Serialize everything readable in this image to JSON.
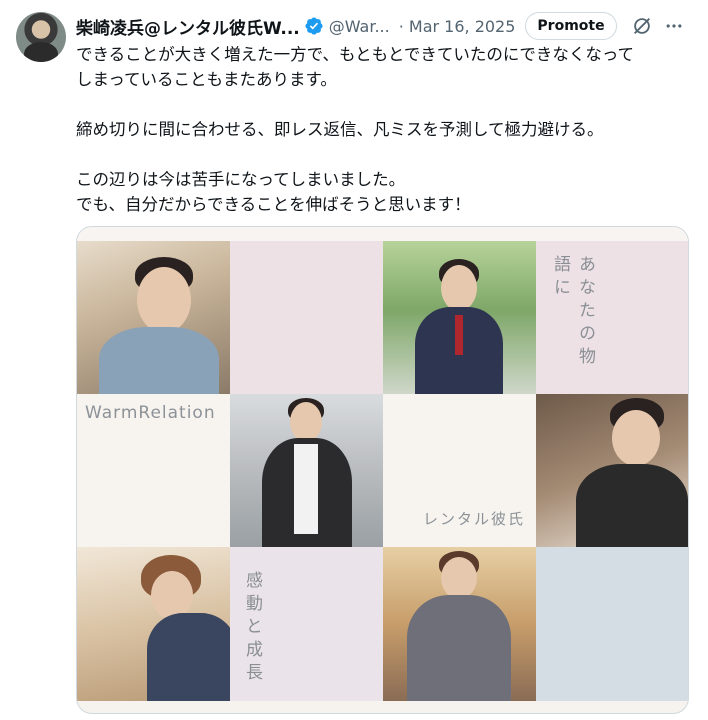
{
  "tweet": {
    "author_name": "柴崎凌兵@レンタル彼氏W...",
    "handle": "@War...",
    "date": "· Mar 16, 2025",
    "promote_label": "Promote",
    "lines": [
      "できることが大きく増えた一方で、もともとできていたのにできなくなって",
      "しまっていることもまたあります。",
      "",
      "締め切りに間に合わせる、即レス返信、凡ミスを予測して極力避ける。",
      "",
      "この辺りは今は苦手になってしまいました。",
      "でも、自分だからできることを伸ばそうと思います！"
    ]
  },
  "media": {
    "brand_text": "WarmRelation",
    "vertical_text_1": "あなたの物語に",
    "vertical_text_2": "感動と成長",
    "label_rental": "レンタル彼氏",
    "colors": {
      "pink": "#ede1e6",
      "cream": "#f7f4ef",
      "bluegray": "#d3dde3"
    }
  },
  "icons": {
    "verified": "verified-badge-icon",
    "grok": "grok-icon",
    "more": "more-icon"
  }
}
